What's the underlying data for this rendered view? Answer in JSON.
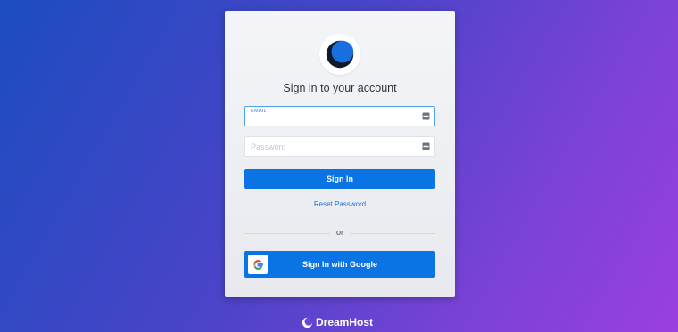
{
  "login": {
    "heading": "Sign in to your account",
    "email": {
      "label": "EMAIL",
      "value": "",
      "placeholder": ""
    },
    "password": {
      "value": "",
      "placeholder": "Password"
    },
    "signin_label": "Sign In",
    "reset_label": "Reset Password",
    "divider_text": "or",
    "google_label": "Sign In with Google"
  },
  "footer": {
    "brand": "DreamHost"
  },
  "icons": {
    "logo": "dreamhost-moon-logo-icon",
    "field_helper": "password-manager-icon",
    "google": "google-g-icon",
    "brand": "dreamhost-moon-icon"
  },
  "colors": {
    "primary_button": "#0b74e5",
    "link": "#1f6fc9",
    "focus_border": "#4fa3e6",
    "background_start": "#1c4cc0",
    "background_end": "#9a3fe0"
  }
}
